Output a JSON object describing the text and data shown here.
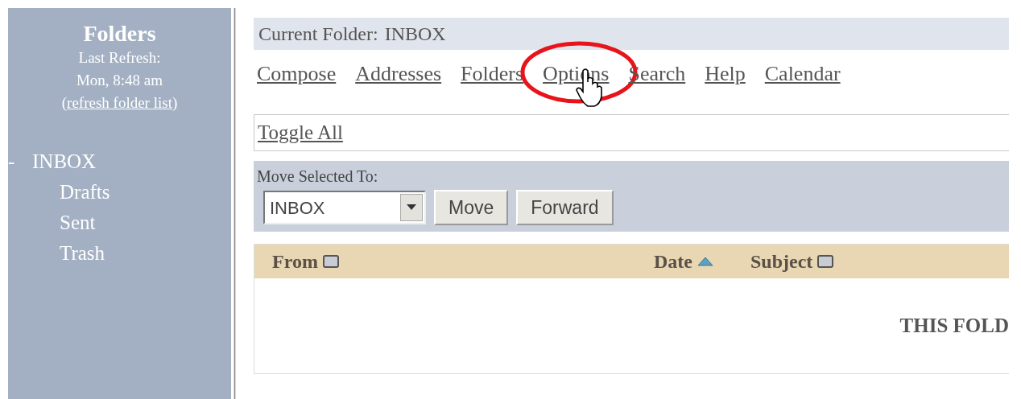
{
  "sidebar": {
    "title": "Folders",
    "refresh_label": "Last Refresh:",
    "refresh_time": "Mon, 8:48 am",
    "refresh_link": "(refresh folder list)",
    "folders": [
      {
        "toggle": "-",
        "name": "INBOX",
        "expanded": true,
        "children": [
          {
            "name": "Drafts"
          },
          {
            "name": "Sent"
          },
          {
            "name": "Trash"
          }
        ]
      }
    ]
  },
  "current_folder": {
    "label": "Current Folder:",
    "name": "INBOX"
  },
  "nav_links": [
    {
      "label": "Compose",
      "circled": false
    },
    {
      "label": "Addresses",
      "circled": false
    },
    {
      "label": "Folders",
      "circled": false
    },
    {
      "label": "Options",
      "circled": true
    },
    {
      "label": "Search",
      "circled": false
    },
    {
      "label": "Help",
      "circled": false
    },
    {
      "label": "Calendar",
      "circled": false
    }
  ],
  "toggle_all": "Toggle All",
  "move_bar": {
    "label": "Move Selected To:",
    "folder_select": "INBOX",
    "buttons": [
      "Move",
      "Forward"
    ]
  },
  "table": {
    "columns": [
      {
        "label": "From",
        "sorted_ascending": false
      },
      {
        "label": "Date",
        "sorted_ascending": true
      },
      {
        "label": "Subject",
        "sorted_ascending": false
      }
    ],
    "empty_message": "THIS FOLD"
  }
}
